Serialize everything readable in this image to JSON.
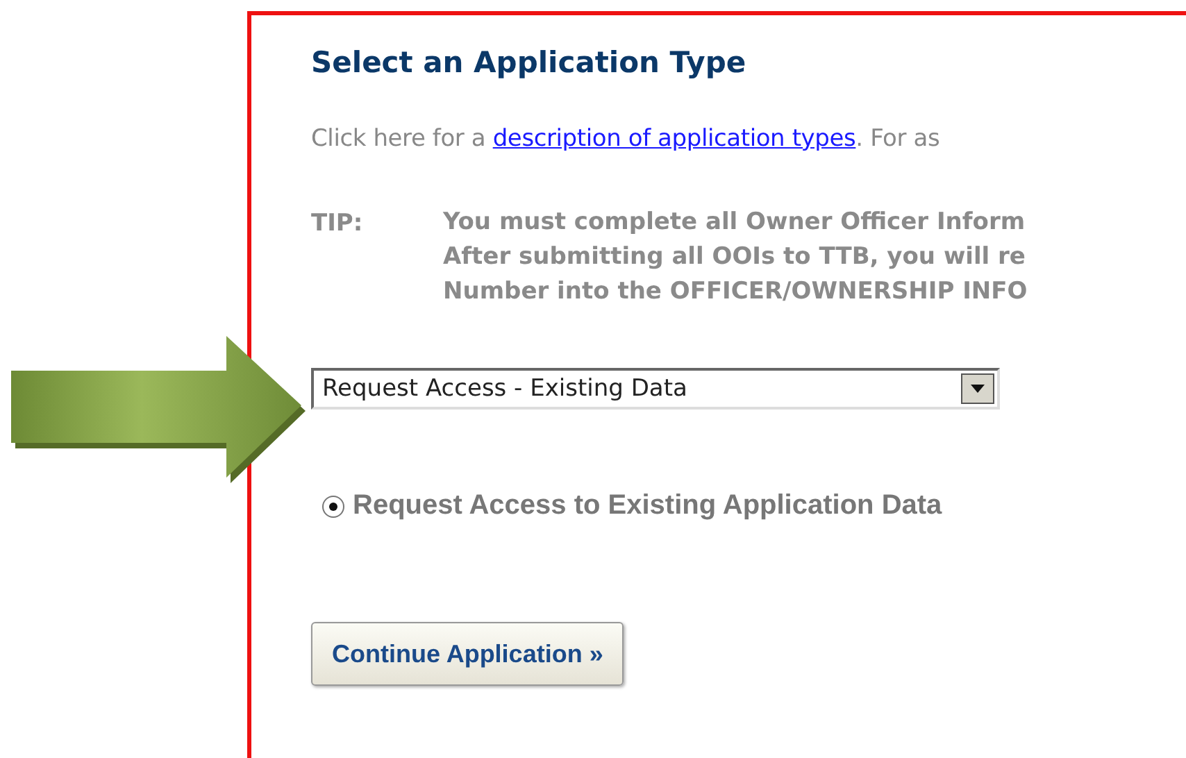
{
  "heading": "Select an Application Type",
  "intro": {
    "before": "Click here for a",
    "link": "description of application types",
    "after": ".  For as"
  },
  "tip": {
    "label": "TIP:",
    "lines": [
      "You must complete all Owner Officer Inform",
      "After submitting all OOIs to TTB, you will re",
      "Number into the OFFICER/OWNERSHIP INFO"
    ]
  },
  "application_type": {
    "value": "Request Access - Existing Data"
  },
  "options": [
    {
      "label": "Request Access to Existing Application Data",
      "selected": true
    }
  ],
  "button": "Continue Application »"
}
